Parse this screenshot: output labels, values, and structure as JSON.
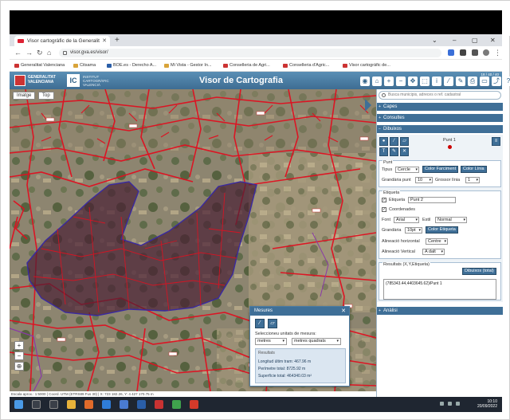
{
  "browser": {
    "tab_title": "Visor cartogràfic de la Generalit",
    "url": "visor.gva.es/visor/",
    "bookmarks": [
      "Generalitat Valenciana",
      "Citsama",
      "BOE.es - Derecho A...",
      "Mi Vista - Gestor In...",
      "Conselleria de Agri...",
      "Conselleria d'Agric...",
      "Visor cartogràfic de..."
    ]
  },
  "app": {
    "logo1_text": "GENERALITAT VALENCIANA",
    "logo2_text": "INSTITUT CARTOGRÀFIC VALENCIÀ",
    "title": "Visor de Cartografia",
    "version": "18 / 40 / 40"
  },
  "map": {
    "tab_left": "Imatge",
    "tab_right": "Top",
    "status": "Escala aprox.: 1:5000 | Coord. UTM (ETRS89 Fus 30) | X: 723 182.26, Y: 4 427 170.75 m"
  },
  "measure_dialog": {
    "title": "Mesures",
    "label": "Seleccioneu unitats de mesura:",
    "unit_length": "metres",
    "unit_area": "metres quadrats",
    "results_title": "Resultats",
    "length_line": "Longitud últim tram: 467.96 m",
    "perimeter_line": "Perímetre total: 8725.92 m",
    "area_line": "Superfície total: 464340.03 m²"
  },
  "panel": {
    "search_placeholder": "Busca municipis, adreces o ref. cadastral",
    "sections": {
      "capes": "Capes",
      "consultes": "Consultes",
      "dibuixos": "Dibuixos",
      "analisi": "Anàlisi"
    },
    "feature_name": "Punt 1",
    "punt": {
      "legend": "Punt",
      "tipus_label": "Tipus",
      "tipus_value": "Cercle",
      "color_fill_btn": "Color Farciment",
      "color_line_btn": "Color Línia",
      "size_label": "Grandària punt",
      "size_value": "10",
      "thickness_label": "Grossor línia",
      "thickness_value": "1"
    },
    "etiqueta": {
      "legend": "Etiqueta",
      "etiqueta_label": "Etiqueta",
      "etiqueta_value": "Punt 2",
      "coordenades_label": "Coordenades",
      "font_label": "Font",
      "font_value": "Arial",
      "estil_label": "Estil",
      "estil_value": "Normal",
      "grandaria_label": "Grandària",
      "grandaria_value": "10pt",
      "color_btn": "Color Etiqueta",
      "align_h_label": "Alineació horizontal",
      "align_h_value": "Centre",
      "align_v_label": "Alineació Vertical",
      "align_v_value": "A dalt"
    },
    "resultats": {
      "legend": "Resultats (X,Y,Etiqueta)",
      "button": "Dibuixos (total)",
      "text": "(785343.44,4403645.62)/Punt 1"
    }
  },
  "taskbar": {
    "time": "10:10",
    "date": "20/09/2022"
  },
  "colors": {
    "accent": "#3f6f97",
    "parcel": "#e01020",
    "polygon": "#5a2a40"
  }
}
